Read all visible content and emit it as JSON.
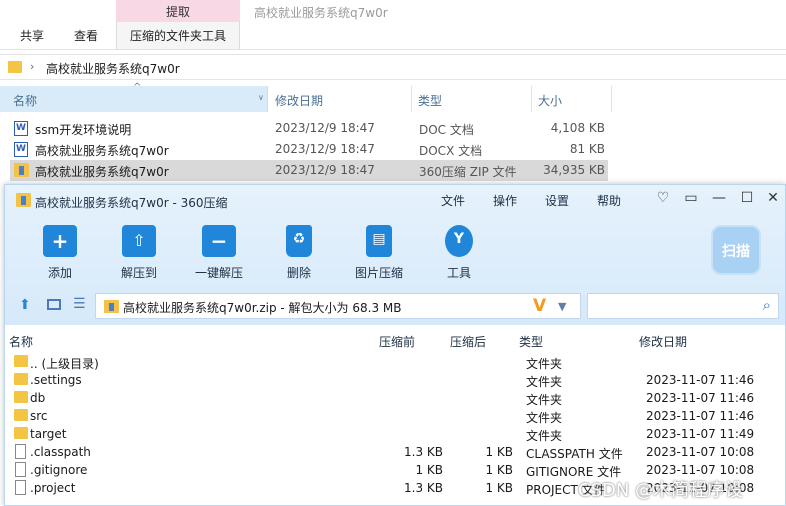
{
  "explorer": {
    "context_tab": "提取",
    "window_title": "高校就业服务系统q7w0r",
    "tabs": {
      "share": "共享",
      "view": "查看",
      "tools": "压缩的文件夹工具"
    },
    "breadcrumb": "高校就业服务系统q7w0r",
    "columns": {
      "name": "名称",
      "date": "修改日期",
      "type": "类型",
      "size": "大小"
    },
    "files": [
      {
        "icon": "W",
        "name": "ssm开发环境说明",
        "date": "2023/12/9 18:47",
        "type": "DOC 文档",
        "size": "4,108 KB"
      },
      {
        "icon": "W",
        "name": "高校就业服务系统q7w0r",
        "date": "2023/12/9 18:47",
        "type": "DOCX 文档",
        "size": "81 KB"
      },
      {
        "icon": "zip",
        "name": "高校就业服务系统q7w0r",
        "date": "2023/12/9 18:47",
        "type": "360压缩 ZIP 文件",
        "size": "34,935 KB"
      }
    ]
  },
  "zip": {
    "title": "高校就业服务系统q7w0r - 360压缩",
    "menu": {
      "file": "文件",
      "ops": "操作",
      "settings": "设置",
      "help": "帮助"
    },
    "toolbar": {
      "add": "添加",
      "extract": "解压到",
      "one_click": "一键解压",
      "delete": "删除",
      "image": "图片压缩",
      "tools": "工具",
      "scan": "扫描"
    },
    "path": "高校就业服务系统q7w0r.zip - 解包大小为 68.3 MB",
    "columns": {
      "name": "名称",
      "before": "压缩前",
      "after": "压缩后",
      "type": "类型",
      "date": "修改日期"
    },
    "rows": [
      {
        "kind": "folder",
        "name": ".. (上级目录)",
        "before": "",
        "after": "",
        "type": "文件夹",
        "date": ""
      },
      {
        "kind": "folder",
        "name": ".settings",
        "before": "",
        "after": "",
        "type": "文件夹",
        "date": "2023-11-07 11:46"
      },
      {
        "kind": "folder",
        "name": "db",
        "before": "",
        "after": "",
        "type": "文件夹",
        "date": "2023-11-07 11:46"
      },
      {
        "kind": "folder",
        "name": "src",
        "before": "",
        "after": "",
        "type": "文件夹",
        "date": "2023-11-07 11:46"
      },
      {
        "kind": "folder",
        "name": "target",
        "before": "",
        "after": "",
        "type": "文件夹",
        "date": "2023-11-07 11:49"
      },
      {
        "kind": "file",
        "name": ".classpath",
        "before": "1.3 KB",
        "after": "1 KB",
        "type": "CLASSPATH 文件",
        "date": "2023-11-07 10:08"
      },
      {
        "kind": "file",
        "name": ".gitignore",
        "before": "1 KB",
        "after": "1 KB",
        "type": "GITIGNORE 文件",
        "date": "2023-11-07 10:08"
      },
      {
        "kind": "file",
        "name": ".project",
        "before": "1.3 KB",
        "after": "1 KB",
        "type": "PROJECT 文件",
        "date": "2023-11-07 10:08"
      }
    ]
  },
  "watermark": "CSDN @木简程序设"
}
